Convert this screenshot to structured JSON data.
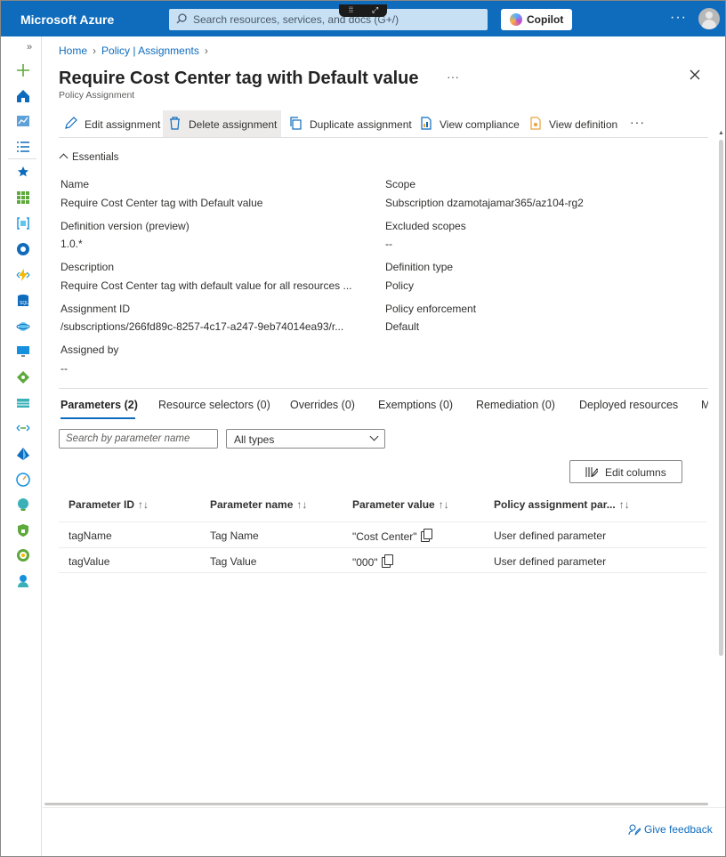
{
  "topbar": {
    "brand": "Microsoft Azure",
    "search_placeholder": "Search resources, services, and docs (G+/)",
    "copilot_label": "Copilot",
    "more": "···"
  },
  "breadcrumb": [
    {
      "label": "Home"
    },
    {
      "label": "Policy | Assignments"
    }
  ],
  "page": {
    "title": "Require Cost Center tag with Default value",
    "subtitle": "Policy Assignment",
    "title_more": "···"
  },
  "commands": [
    {
      "label": "Edit assignment",
      "icon": "pencil-icon"
    },
    {
      "label": "Delete assignment",
      "icon": "trash-icon"
    },
    {
      "label": "Duplicate assignment",
      "icon": "duplicate-icon"
    },
    {
      "label": "View compliance",
      "icon": "compliance-icon"
    },
    {
      "label": "View definition",
      "icon": "definition-icon"
    }
  ],
  "essentials": {
    "toggle_label": "Essentials",
    "left": [
      {
        "label": "Name",
        "value": "Require Cost Center tag with Default value"
      },
      {
        "label": "Definition version (preview)",
        "value": "1.0.*"
      },
      {
        "label": "Description",
        "value": "Require Cost Center tag with default value for all resources ..."
      },
      {
        "label": "Assignment ID",
        "value": "/subscriptions/266fd89c-8257-4c17-a247-9eb74014ea93/r..."
      },
      {
        "label": "Assigned by",
        "value": "--"
      }
    ],
    "right": [
      {
        "label": "Scope",
        "value": "Subscription dzamotajamar365/az104-rg2"
      },
      {
        "label": "Excluded scopes",
        "value": "--"
      },
      {
        "label": "Definition type",
        "value": "Policy"
      },
      {
        "label": "Policy enforcement",
        "value": "Default"
      }
    ]
  },
  "tabs": [
    {
      "label": "Parameters (2)"
    },
    {
      "label": "Resource selectors (0)"
    },
    {
      "label": "Overrides (0)"
    },
    {
      "label": "Exemptions (0)"
    },
    {
      "label": "Remediation (0)"
    },
    {
      "label": "Deployed resources"
    },
    {
      "label": "Mar"
    }
  ],
  "filters": {
    "search_placeholder": "Search by parameter name",
    "type_value": "All types",
    "edit_columns_label": "Edit columns"
  },
  "table": {
    "columns": [
      "Parameter ID",
      "Parameter name",
      "Parameter value",
      "Policy assignment par..."
    ],
    "sort_glyph": "↑↓",
    "rows": [
      [
        "tagName",
        "Tag Name",
        "\"Cost Center\"",
        "User defined parameter"
      ],
      [
        "tagValue",
        "Tag Value",
        "\"000\"",
        "User defined parameter"
      ]
    ]
  },
  "footer": {
    "feedback_label": "Give feedback"
  },
  "colors": {
    "azure_blue": "#0f6cbd",
    "search_bg": "#c7e0f4"
  }
}
